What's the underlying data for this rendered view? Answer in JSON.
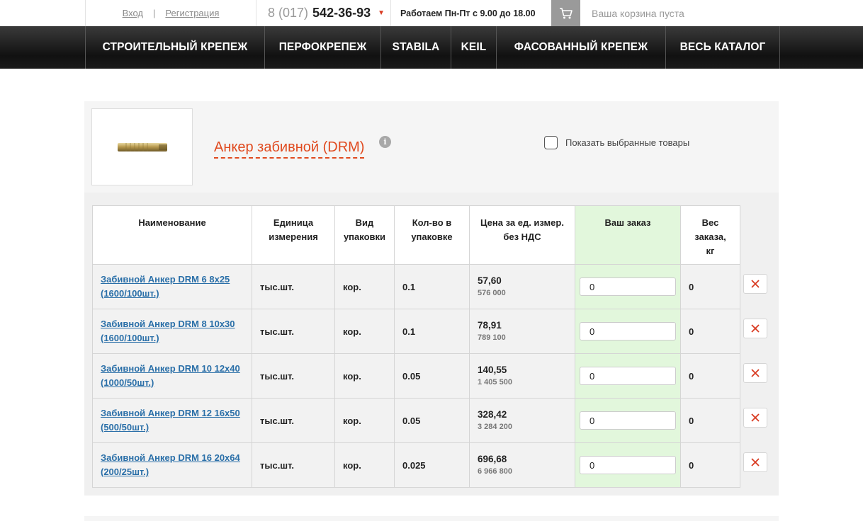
{
  "header": {
    "login": "Вход",
    "separator": "|",
    "register": "Регистрация",
    "phone_prefix": "8 (017)",
    "phone_number": "542-36-93",
    "work_hours": "Работаем Пн-Пт с 9.00 до 18.00",
    "cart_text": "Ваша корзина пуста"
  },
  "nav": [
    {
      "label": "СТРОИТЕЛЬНЫЙ КРЕПЕЖ"
    },
    {
      "label": "ПЕРФОКРЕПЕЖ"
    },
    {
      "label": "STABILA"
    },
    {
      "label": "KEIL"
    },
    {
      "label": "ФАСОВАННЫЙ КРЕПЕЖ"
    },
    {
      "label": "ВЕСЬ КАТАЛОГ"
    }
  ],
  "product": {
    "title": "Анкер забивной (DRM)",
    "info": "i",
    "show_selected": "Показать выбранные товары"
  },
  "table": {
    "headers": {
      "name": "Наименование",
      "unit_1": "Единица",
      "unit_2": "измерения",
      "pack_1": "Вид",
      "pack_2": "упаковки",
      "qty_1": "Кол-во в",
      "qty_2": "упаковке",
      "price_1": "Цена за ед. измер.",
      "price_2": "без НДС",
      "order": "Ваш заказ",
      "weight_1": "Вес",
      "weight_2": "заказа,",
      "weight_3": "кг"
    },
    "rows": [
      {
        "name_1": "Забивной Анкер DRM 6 8x25",
        "name_2": "(1600/100шт.)",
        "unit": "тыс.шт.",
        "pack": "кор.",
        "qty": "0.1",
        "price": "57,60",
        "price_sub": "576 000",
        "order": "0",
        "weight": "0"
      },
      {
        "name_1": "Забивной Анкер DRM 8 10x30",
        "name_2": "(1600/100шт.)",
        "unit": "тыс.шт.",
        "pack": "кор.",
        "qty": "0.1",
        "price": "78,91",
        "price_sub": "789 100",
        "order": "0",
        "weight": "0"
      },
      {
        "name_1": "Забивной Анкер DRM 10 12x40",
        "name_2": "(1000/50шт.)",
        "unit": "тыс.шт.",
        "pack": "кор.",
        "qty": "0.05",
        "price": "140,55",
        "price_sub": "1 405 500",
        "order": "0",
        "weight": "0"
      },
      {
        "name_1": "Забивной Анкер DRM 12 16x50",
        "name_2": "(500/50шт.)",
        "unit": "тыс.шт.",
        "pack": "кор.",
        "qty": "0.05",
        "price": "328,42",
        "price_sub": "3 284 200",
        "order": "0",
        "weight": "0"
      },
      {
        "name_1": "Забивной Анкер DRM 16 20x64",
        "name_2": "(200/25шт.)",
        "unit": "тыс.шт.",
        "pack": "кор.",
        "qty": "0.025",
        "price": "696,68",
        "price_sub": "6 966 800",
        "order": "0",
        "weight": "0"
      }
    ]
  },
  "colors": {
    "accent": "#e04a1f",
    "link": "#2a6fa8",
    "order_column": "#e2f7dc",
    "delete_icon": "#d93b22"
  },
  "icons": {
    "cart": "cart-icon",
    "phone_dropdown": "triangle-down-icon",
    "info": "info-icon",
    "delete": "close-icon"
  }
}
